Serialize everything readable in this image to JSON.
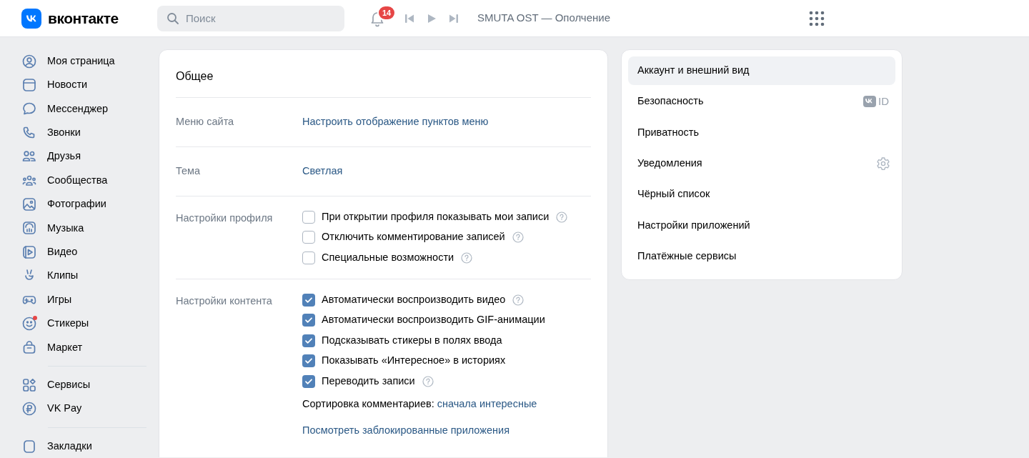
{
  "header": {
    "logo_text": "вконтакте",
    "search": {
      "placeholder": "Поиск"
    },
    "notifications": {
      "count": "14"
    },
    "player": {
      "track": "SMUTA OST — Ополчение"
    }
  },
  "sidebar": {
    "groups": [
      [
        {
          "label": "Моя страница",
          "dot": false
        },
        {
          "label": "Новости",
          "dot": false
        },
        {
          "label": "Мессенджер",
          "dot": false
        },
        {
          "label": "Звонки",
          "dot": false
        },
        {
          "label": "Друзья",
          "dot": false
        },
        {
          "label": "Сообщества",
          "dot": false
        },
        {
          "label": "Фотографии",
          "dot": false
        },
        {
          "label": "Музыка",
          "dot": false
        },
        {
          "label": "Видео",
          "dot": false
        },
        {
          "label": "Клипы",
          "dot": false
        },
        {
          "label": "Игры",
          "dot": false
        },
        {
          "label": "Стикеры",
          "dot": true
        },
        {
          "label": "Маркет",
          "dot": false
        }
      ],
      [
        {
          "label": "Сервисы",
          "dot": false
        },
        {
          "label": "VK Pay",
          "dot": false
        }
      ],
      [
        {
          "label": "Закладки",
          "dot": false
        }
      ]
    ]
  },
  "settings": {
    "title": "Общее",
    "rows": [
      {
        "label": "Меню сайта",
        "kind": "link",
        "value": "Настроить отображение пунктов меню"
      },
      {
        "label": "Тема",
        "kind": "link",
        "value": "Светлая"
      },
      {
        "label": "Настройки профиля",
        "kind": "checkboxes",
        "options": [
          {
            "label": "При открытии профиля показывать мои записи",
            "checked": false,
            "help": true
          },
          {
            "label": "Отключить комментирование записей",
            "checked": false,
            "help": true
          },
          {
            "label": "Специальные возможности",
            "checked": false,
            "help": true
          }
        ]
      },
      {
        "label": "Настройки контента",
        "kind": "checkboxes",
        "options": [
          {
            "label": "Автоматически воспроизводить видео",
            "checked": true,
            "help": true
          },
          {
            "label": "Автоматически воспроизводить GIF-анимации",
            "checked": true,
            "help": false
          },
          {
            "label": "Подсказывать стикеры в полях ввода",
            "checked": true,
            "help": false
          },
          {
            "label": "Показывать «Интересное» в историях",
            "checked": true,
            "help": false
          },
          {
            "label": "Переводить записи",
            "checked": true,
            "help": true
          }
        ],
        "sort": {
          "label": "Сортировка комментариев:",
          "value": "сначала интересные"
        },
        "link": "Посмотреть заблокированные приложения"
      }
    ]
  },
  "menu": [
    {
      "label": "Аккаунт и внешний вид",
      "selected": true
    },
    {
      "label": "Безопасность",
      "selected": false,
      "accessory": {
        "kind": "vk-id",
        "text": "ID"
      }
    },
    {
      "label": "Приватность",
      "selected": false
    },
    {
      "label": "Уведомления",
      "selected": false,
      "accessory": {
        "kind": "settings"
      }
    },
    {
      "label": "Чёрный список",
      "selected": false
    },
    {
      "label": "Настройки приложений",
      "selected": false
    },
    {
      "label": "Платёжные сервисы",
      "selected": false
    }
  ]
}
